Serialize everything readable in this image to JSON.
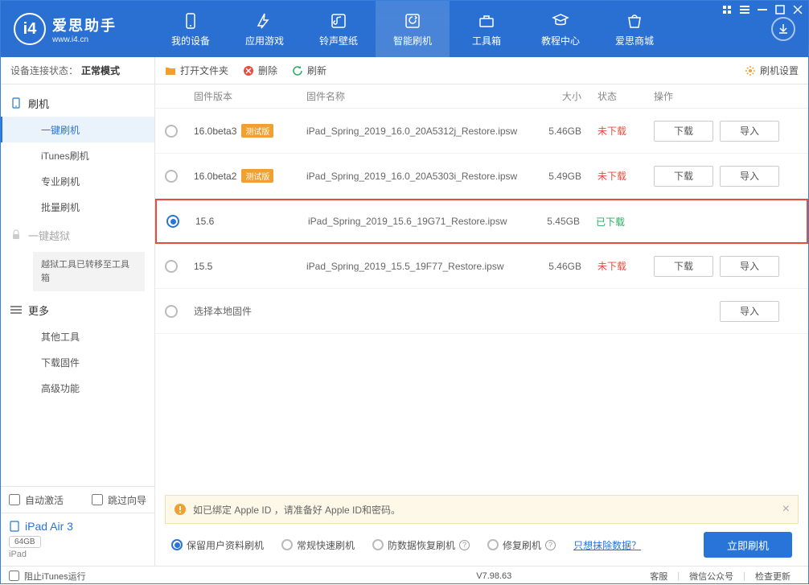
{
  "header": {
    "logo_title": "爱思助手",
    "logo_sub": "www.i4.cn",
    "tabs": [
      {
        "label": "我的设备",
        "icon": "device"
      },
      {
        "label": "应用游戏",
        "icon": "apps"
      },
      {
        "label": "铃声壁纸",
        "icon": "music"
      },
      {
        "label": "智能刷机",
        "icon": "flash"
      },
      {
        "label": "工具箱",
        "icon": "toolbox"
      },
      {
        "label": "教程中心",
        "icon": "tutorial"
      },
      {
        "label": "爱思商城",
        "icon": "store"
      }
    ]
  },
  "sidebar": {
    "status_label": "设备连接状态：",
    "status_mode": "正常模式",
    "flash_group": "刷机",
    "flash_items": [
      "一键刷机",
      "iTunes刷机",
      "专业刷机",
      "批量刷机"
    ],
    "jailbreak_group": "一键越狱",
    "jailbreak_note": "越狱工具已转移至工具箱",
    "more_group": "更多",
    "more_items": [
      "其他工具",
      "下载固件",
      "高级功能"
    ],
    "auto_activate": "自动激活",
    "skip_guide": "跳过向导",
    "device_name": "iPad Air 3",
    "device_capacity": "64GB",
    "device_type": "iPad"
  },
  "toolbar": {
    "open_folder": "打开文件夹",
    "delete": "删除",
    "refresh": "刷新",
    "settings": "刷机设置"
  },
  "table": {
    "col_version": "固件版本",
    "col_name": "固件名称",
    "col_size": "大小",
    "col_status": "状态",
    "col_ops": "操作"
  },
  "firmware": [
    {
      "version": "16.0beta3",
      "beta": "测试版",
      "name": "iPad_Spring_2019_16.0_20A5312j_Restore.ipsw",
      "size": "5.46GB",
      "status": "未下载",
      "status_class": "red",
      "selected": false,
      "ops": true
    },
    {
      "version": "16.0beta2",
      "beta": "测试版",
      "name": "iPad_Spring_2019_16.0_20A5303i_Restore.ipsw",
      "size": "5.49GB",
      "status": "未下载",
      "status_class": "red",
      "selected": false,
      "ops": true
    },
    {
      "version": "15.6",
      "beta": "",
      "name": "iPad_Spring_2019_15.6_19G71_Restore.ipsw",
      "size": "5.45GB",
      "status": "已下载",
      "status_class": "green",
      "selected": true,
      "ops": false,
      "highlighted": true
    },
    {
      "version": "15.5",
      "beta": "",
      "name": "iPad_Spring_2019_15.5_19F77_Restore.ipsw",
      "size": "5.46GB",
      "status": "未下载",
      "status_class": "red",
      "selected": false,
      "ops": true
    }
  ],
  "local_firmware": "选择本地固件",
  "buttons": {
    "download": "下载",
    "import": "导入"
  },
  "warning": "如已绑定 Apple ID ，请准备好 Apple ID和密码。",
  "options": {
    "keep_data": "保留用户资料刷机",
    "normal": "常规快速刷机",
    "anti_recovery": "防数据恢复刷机",
    "repair": "修复刷机",
    "erase_link": "只想抹除数据？",
    "flash_now": "立即刷机"
  },
  "footer": {
    "block_itunes": "阻止iTunes运行",
    "version": "V7.98.63",
    "service": "客服",
    "wechat": "微信公众号",
    "update": "检查更新"
  }
}
